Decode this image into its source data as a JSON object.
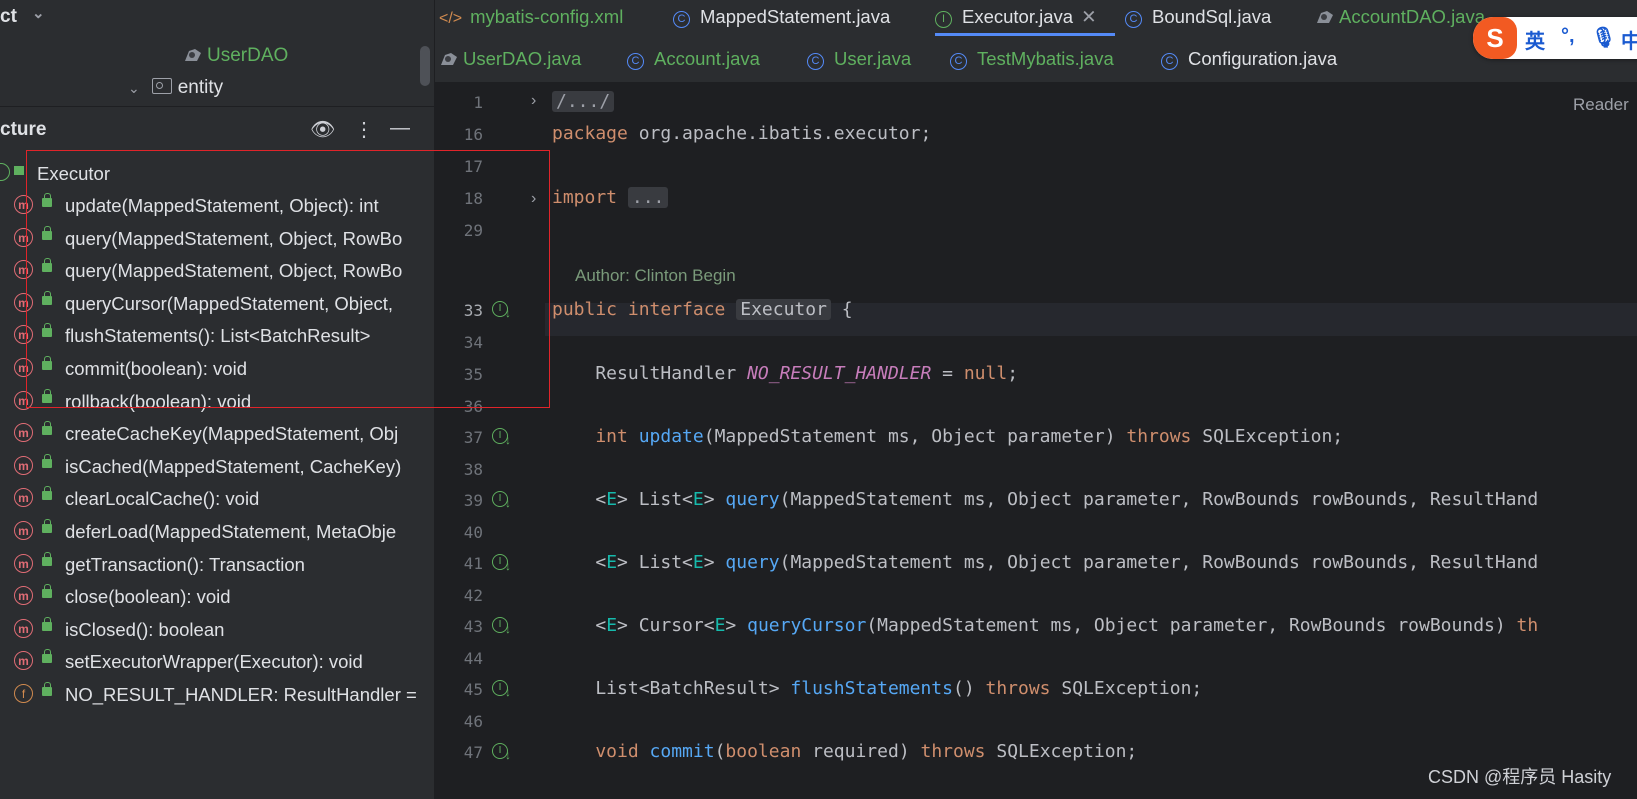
{
  "project": {
    "title": "ct"
  },
  "tree": {
    "dao_item": "UserDAO",
    "entity_item": "entity"
  },
  "structure": {
    "title": "cture",
    "root": "Executor",
    "items": [
      {
        "kind": "m",
        "label": "update(MappedStatement, Object): int"
      },
      {
        "kind": "m",
        "label": "query(MappedStatement, Object, RowBo"
      },
      {
        "kind": "m",
        "label": "query(MappedStatement, Object, RowBo"
      },
      {
        "kind": "m",
        "label": "queryCursor(MappedStatement, Object, "
      },
      {
        "kind": "m",
        "label": "flushStatements(): List<BatchResult>"
      },
      {
        "kind": "m",
        "label": "commit(boolean): void"
      },
      {
        "kind": "m",
        "label": "rollback(boolean): void"
      },
      {
        "kind": "m",
        "label": "createCacheKey(MappedStatement, Obj"
      },
      {
        "kind": "m",
        "label": "isCached(MappedStatement, CacheKey)"
      },
      {
        "kind": "m",
        "label": "clearLocalCache(): void"
      },
      {
        "kind": "m",
        "label": "deferLoad(MappedStatement, MetaObje"
      },
      {
        "kind": "m",
        "label": "getTransaction(): Transaction"
      },
      {
        "kind": "m",
        "label": "close(boolean): void"
      },
      {
        "kind": "m",
        "label": "isClosed(): boolean"
      },
      {
        "kind": "m",
        "label": "setExecutorWrapper(Executor): void"
      },
      {
        "kind": "f",
        "label": "NO_RESULT_HANDLER: ResultHandler ="
      }
    ]
  },
  "tabs_row1": [
    {
      "label": "mybatis-config.xml",
      "type": "xml"
    },
    {
      "label": "MappedStatement.java",
      "type": "class"
    },
    {
      "label": "Executor.java",
      "type": "interface",
      "active": true
    },
    {
      "label": "BoundSql.java",
      "type": "class"
    },
    {
      "label": "AccountDAO.java",
      "type": "dao"
    }
  ],
  "tabs_row2": [
    {
      "label": "UserDAO.java",
      "type": "dao"
    },
    {
      "label": "Account.java",
      "type": "class"
    },
    {
      "label": "User.java",
      "type": "class"
    },
    {
      "label": "TestMybatis.java",
      "type": "class"
    },
    {
      "label": "Configuration.java",
      "type": "class"
    }
  ],
  "editor": {
    "reader_mode": "Reader",
    "author": "Author: Clinton Begin",
    "line_numbers": [
      "1",
      "16",
      "17",
      "18",
      "29",
      "33",
      "34",
      "35",
      "36",
      "37",
      "38",
      "39",
      "40",
      "41",
      "42",
      "43",
      "44",
      "45",
      "46",
      "47"
    ],
    "lines": {
      "l1": "/.../",
      "l16": "package org.apache.ibatis.executor;",
      "l18_kw": "import",
      "l18_fold": "...",
      "l33_a": "public interface ",
      "l33_b": "Executor",
      "l33_c": " {",
      "l35_a": "    ResultHandler ",
      "l35_b": "NO_RESULT_HANDLER",
      "l35_c": " = ",
      "l35_d": "null",
      "l35_e": ";",
      "l37_a": "    int ",
      "l37_b": "update",
      "l37_c": "(MappedStatement ms, Object parameter) ",
      "l37_d": "throws",
      "l37_e": " SQLException;",
      "l39_a": "    <",
      "l39_g": "E",
      "l39_b": "> List<",
      "l39_g2": "E",
      "l39_c": "> ",
      "l39_d": "query",
      "l39_e": "(MappedStatement ms, Object parameter, RowBounds rowBounds, ResultHand",
      "l41_e": "(MappedStatement ms, Object parameter, RowBounds rowBounds, ResultHand",
      "l43_b": "> Cursor<",
      "l43_d": "queryCursor",
      "l43_e": "(MappedStatement ms, Object parameter, RowBounds rowBounds) ",
      "l43_f": "th",
      "l45_a": "    List<BatchResult> ",
      "l45_b": "flushStatements",
      "l45_c": "() ",
      "l45_d": "throws",
      "l45_e": " SQLException;",
      "l47_a": "    void ",
      "l47_b": "commit",
      "l47_c": "(",
      "l47_d": "boolean",
      "l47_e": " required) ",
      "l47_f": "throws",
      "l47_g": " SQLException;"
    }
  },
  "ime": {
    "logo": "S",
    "lang": "英",
    "punct": "°,",
    "extra": "中"
  },
  "watermark": "CSDN @程序员 Hasity"
}
